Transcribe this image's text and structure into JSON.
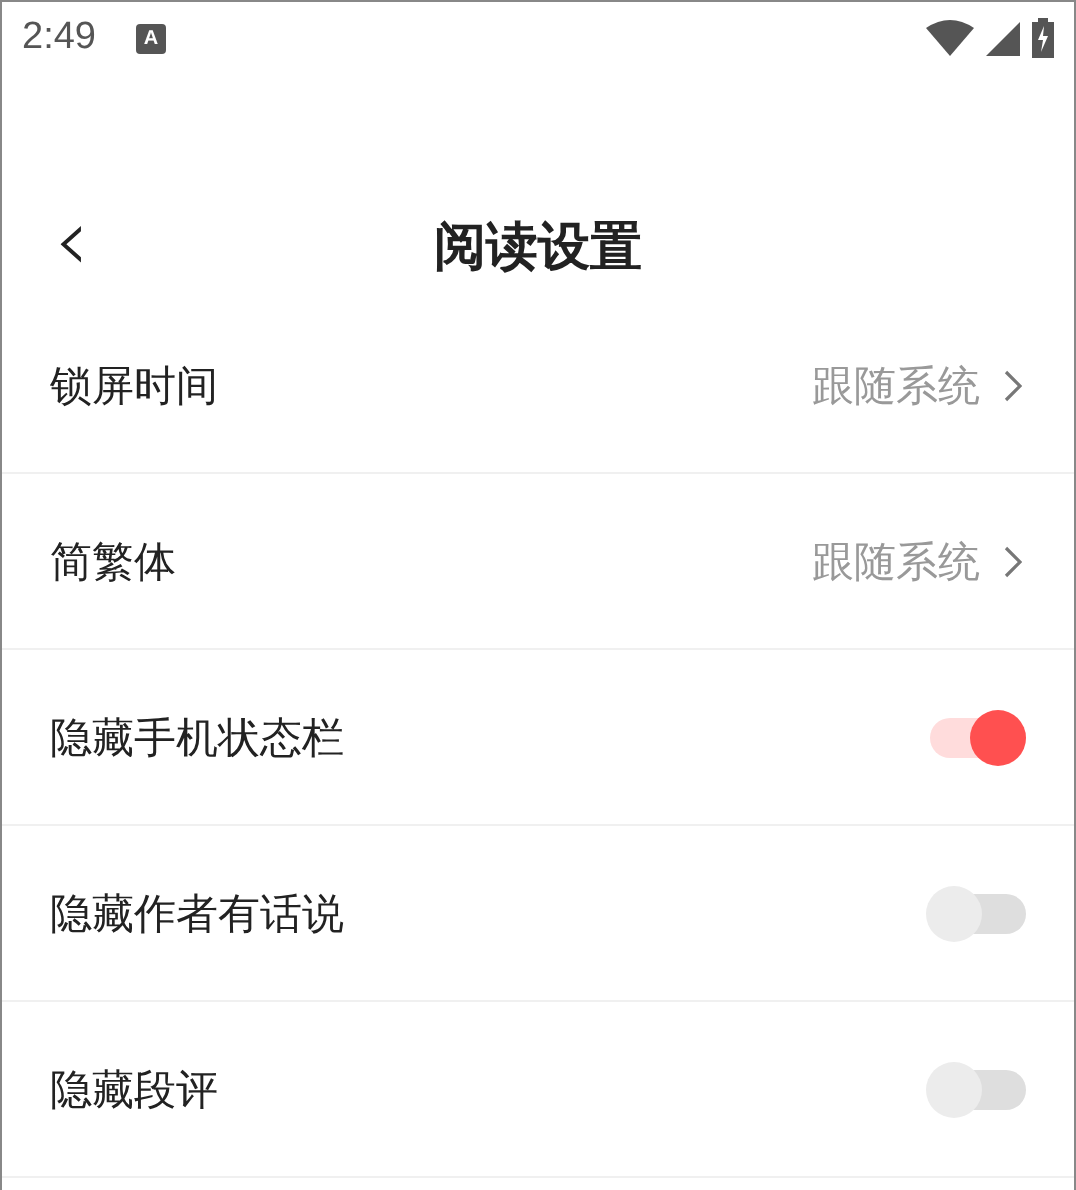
{
  "status_bar": {
    "time": "2:49",
    "notification": "A"
  },
  "header": {
    "back": "‹",
    "title": "阅读设置"
  },
  "settings": [
    {
      "kind": "link",
      "label": "锁屏时间",
      "value": "跟随系统"
    },
    {
      "kind": "link",
      "label": "简繁体",
      "value": "跟随系统"
    },
    {
      "kind": "toggle",
      "label": "隐藏手机状态栏",
      "on": true
    },
    {
      "kind": "toggle",
      "label": "隐藏作者有话说",
      "on": false
    },
    {
      "kind": "toggle",
      "label": "隐藏段评",
      "on": false
    }
  ]
}
